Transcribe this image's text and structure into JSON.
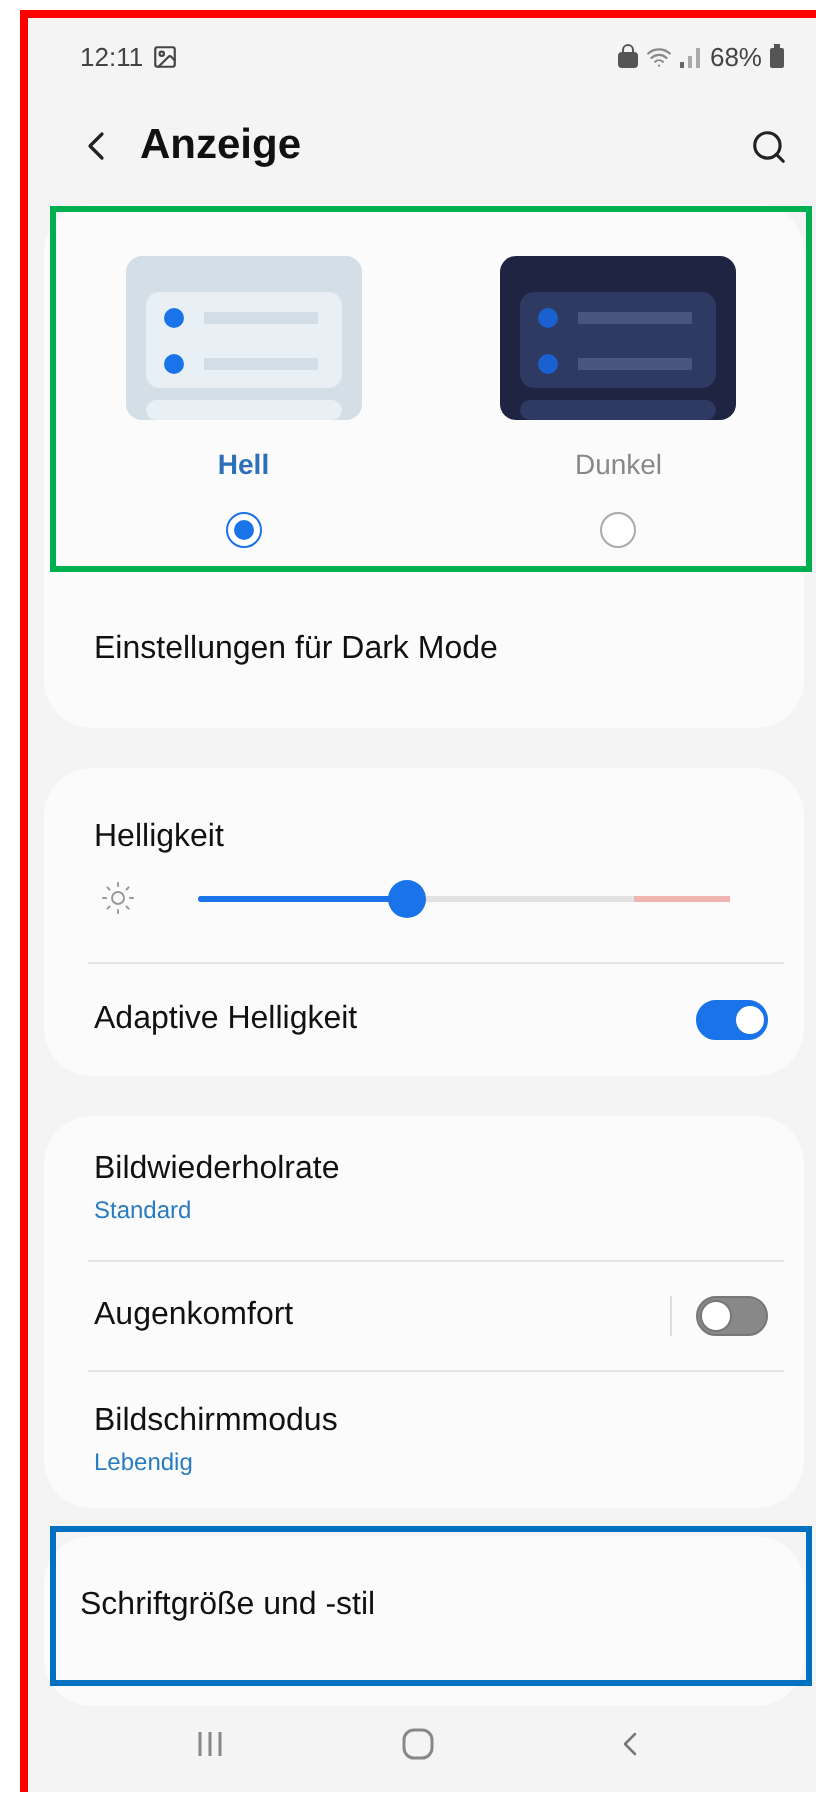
{
  "status_bar": {
    "time": "12:11",
    "battery": "68%"
  },
  "header": {
    "title": "Anzeige"
  },
  "themes": [
    {
      "label": "Hell",
      "kind": "light",
      "selected": true
    },
    {
      "label": "Dunkel",
      "kind": "dark",
      "selected": false
    }
  ],
  "dark_mode_row": {
    "label": "Einstellungen für Dark Mode"
  },
  "brightness_card": {
    "title": "Helligkeit",
    "level": 0.39,
    "adaptive": {
      "label": "Adaptive Helligkeit",
      "on": true
    }
  },
  "display_card": [
    {
      "kind": "link",
      "label": "Bildwiederholrate",
      "value": "Standard"
    },
    {
      "kind": "toggle",
      "label": "Augenkomfort",
      "on": false
    },
    {
      "kind": "link",
      "label": "Bildschirmmodus",
      "value": "Lebendig"
    }
  ],
  "font_card": {
    "label": "Schriftgröße und -stil"
  }
}
